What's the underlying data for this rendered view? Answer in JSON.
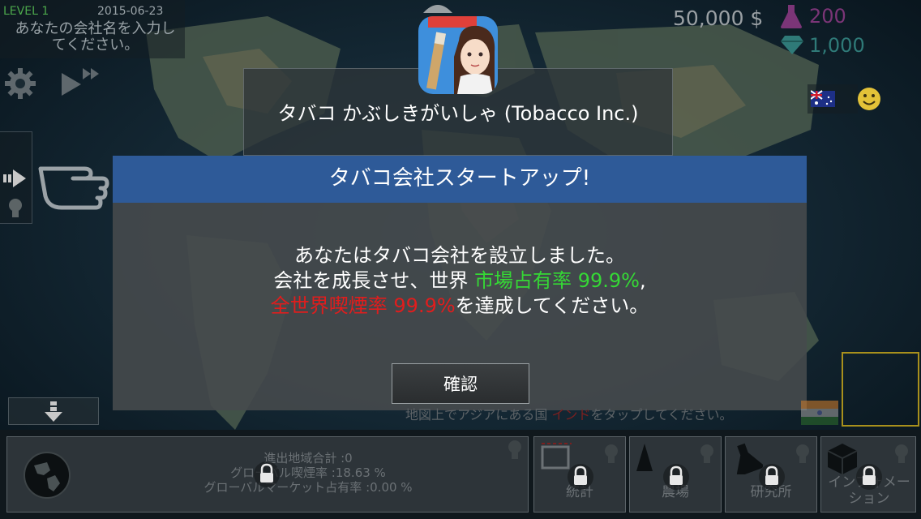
{
  "header": {
    "level": "LEVEL 1",
    "date": "2015-06-23",
    "company_placeholder": "あなたの会社名を入力してください。"
  },
  "stats_top": {
    "money": "50,000 $",
    "research_points": "200",
    "gems": "1,000"
  },
  "app": {
    "title": "タバコ かぶしきがいしゃ (Tobacco Inc.)"
  },
  "dialog": {
    "title": "タバコ会社スタートアップ!",
    "line1": "あなたはタバコ会社を設立しました。",
    "line2_prefix": "会社を成長させ、世界 ",
    "line2_highlight": "市場占有率 99.9%",
    "line2_suffix": ",",
    "line3_highlight": "全世界喫煙率 99.9%",
    "line3_suffix": "を達成してください。",
    "confirm_label": "確認"
  },
  "hint": {
    "prefix": "地図上でアジアにある国 ",
    "highlight": "インド",
    "suffix": "をタップしてください。"
  },
  "bottom": {
    "stats": [
      "進出地域合計 :0",
      "グローバル喫煙率 :18.63 %",
      "グローバルマーケット占有率 :0.00 %"
    ],
    "tabs": [
      {
        "label": "統計"
      },
      {
        "label": "農場"
      },
      {
        "label": "研究所"
      },
      {
        "label": "インフォメーション"
      }
    ]
  },
  "colors": {
    "dialog_header": "#2e5a98",
    "highlight_green": "#35d935",
    "highlight_red": "#e01d1d",
    "level_green": "#4ca84c",
    "research_purple": "#7b3577",
    "gem_teal": "#2f7a78"
  },
  "icons": [
    "gear-icon",
    "fast-forward-icon",
    "pointing-hand-icon",
    "arrow-right-icon",
    "lightbulb-icon",
    "arrow-down-icon",
    "flask-icon",
    "diamond-icon",
    "australia-flag-icon",
    "smiley-icon",
    "india-flag-icon",
    "globe-icon",
    "lock-icon",
    "chart-icon",
    "farm-icon",
    "lab-icon",
    "cube-icon"
  ]
}
